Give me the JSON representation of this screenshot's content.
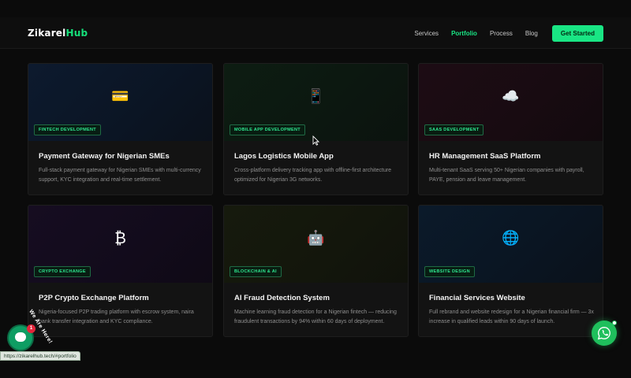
{
  "brand": {
    "name": "Zikarel",
    "name_accent": "Hub"
  },
  "nav": {
    "items": [
      {
        "label": "Services",
        "active": false
      },
      {
        "label": "Portfolio",
        "active": true
      },
      {
        "label": "Process",
        "active": false
      },
      {
        "label": "Blog",
        "active": false
      }
    ],
    "cta_label": "Get Started"
  },
  "colors": {
    "accent": "#19e584",
    "background": "#0b0b0b",
    "card": "#131313"
  },
  "projects": [
    {
      "icon": "credit-card-icon",
      "glyph": "💳",
      "tag": "Fintech Development",
      "title": "Payment Gateway for Nigerian SMEs",
      "description": "Full-stack payment gateway for Nigerian SMEs with multi-currency support, KYC integration and real-time settlement."
    },
    {
      "icon": "mobile-phone-icon",
      "glyph": "📱",
      "tag": "Mobile App Development",
      "title": "Lagos Logistics Mobile App",
      "description": "Cross-platform delivery tracking app with offline-first architecture optimized for Nigerian 3G networks."
    },
    {
      "icon": "cloud-icon",
      "glyph": "☁️",
      "tag": "SaaS Development",
      "title": "HR Management SaaS Platform",
      "description": "Multi-tenant SaaS serving 50+ Nigerian companies with payroll, PAYE, pension and leave management."
    },
    {
      "icon": "bitcoin-icon",
      "glyph": "₿",
      "tag": "Crypto Exchange",
      "title": "P2P Crypto Exchange Platform",
      "description": "Nigeria-focused P2P trading platform with escrow system, naira bank transfer integration and KYC compliance."
    },
    {
      "icon": "robot-icon",
      "glyph": "🤖",
      "tag": "Blockchain & AI",
      "title": "AI Fraud Detection System",
      "description": "Machine learning fraud detection for a Nigerian fintech — reducing fraudulent transactions by 94% within 60 days of deployment."
    },
    {
      "icon": "globe-icon",
      "glyph": "🌐",
      "tag": "Website Design",
      "title": "Financial Services Website",
      "description": "Full rebrand and website redesign for a Nigerian financial firm — 3x increase in qualified leads within 90 days of launch."
    }
  ],
  "chat_widget": {
    "label": "We Are Here!",
    "badge": "1"
  },
  "status_url": "https://zikarelhub.tech/#portfolio"
}
